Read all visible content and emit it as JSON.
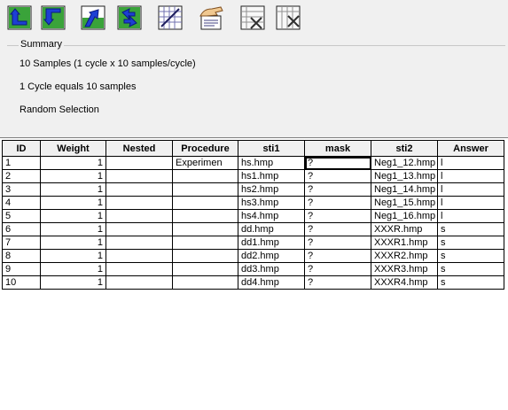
{
  "toolbar": {
    "buttons": [
      {
        "name": "move-up-icon",
        "color": "#1d3fd4"
      },
      {
        "name": "move-down-icon",
        "color": "#1d3fd4"
      },
      {
        "name": "insert-icon",
        "color": "#1d3fd4"
      },
      {
        "name": "refresh-icon",
        "color": "#1d3fd4"
      },
      {
        "name": "grid-edit-icon",
        "color": "#5a5aa0"
      },
      {
        "name": "hand-point-icon",
        "color": "#c08040"
      },
      {
        "name": "delete-row-icon",
        "color": "#404040"
      },
      {
        "name": "delete-column-icon",
        "color": "#404040"
      }
    ]
  },
  "summary": {
    "legend": "Summary",
    "line1": "10 Samples (1 cycle x 10 samples/cycle)",
    "line2": "1 Cycle equals 10 samples",
    "line3": "Random Selection"
  },
  "grid": {
    "columns": [
      "ID",
      "Weight",
      "Nested",
      "Procedure",
      "sti1",
      "mask",
      "sti2",
      "Answer"
    ],
    "rows": [
      {
        "id": "1",
        "weight": "1",
        "nested": "",
        "procedure": "Experimen",
        "sti1": "hs.hmp",
        "mask": "?",
        "sti2": "Neg1_12.hmp",
        "answer": "l"
      },
      {
        "id": "2",
        "weight": "1",
        "nested": "",
        "procedure": "",
        "sti1": "hs1.hmp",
        "mask": "?",
        "sti2": "Neg1_13.hmp",
        "answer": "l"
      },
      {
        "id": "3",
        "weight": "1",
        "nested": "",
        "procedure": "",
        "sti1": "hs2.hmp",
        "mask": "?",
        "sti2": "Neg1_14.hmp",
        "answer": "l"
      },
      {
        "id": "4",
        "weight": "1",
        "nested": "",
        "procedure": "",
        "sti1": "hs3.hmp",
        "mask": "?",
        "sti2": "Neg1_15.hmp",
        "answer": "l"
      },
      {
        "id": "5",
        "weight": "1",
        "nested": "",
        "procedure": "",
        "sti1": "hs4.hmp",
        "mask": "?",
        "sti2": "Neg1_16.hmp",
        "answer": "l"
      },
      {
        "id": "6",
        "weight": "1",
        "nested": "",
        "procedure": "",
        "sti1": "dd.hmp",
        "mask": "?",
        "sti2": "XXXR.hmp",
        "answer": "s"
      },
      {
        "id": "7",
        "weight": "1",
        "nested": "",
        "procedure": "",
        "sti1": "dd1.hmp",
        "mask": "?",
        "sti2": "XXXR1.hmp",
        "answer": "s"
      },
      {
        "id": "8",
        "weight": "1",
        "nested": "",
        "procedure": "",
        "sti1": "dd2.hmp",
        "mask": "?",
        "sti2": "XXXR2.hmp",
        "answer": "s"
      },
      {
        "id": "9",
        "weight": "1",
        "nested": "",
        "procedure": "",
        "sti1": "dd3.hmp",
        "mask": "?",
        "sti2": "XXXR3.hmp",
        "answer": "s"
      },
      {
        "id": "10",
        "weight": "1",
        "nested": "",
        "procedure": "",
        "sti1": "dd4.hmp",
        "mask": "?",
        "sti2": "XXXR4.hmp",
        "answer": "s"
      }
    ]
  }
}
